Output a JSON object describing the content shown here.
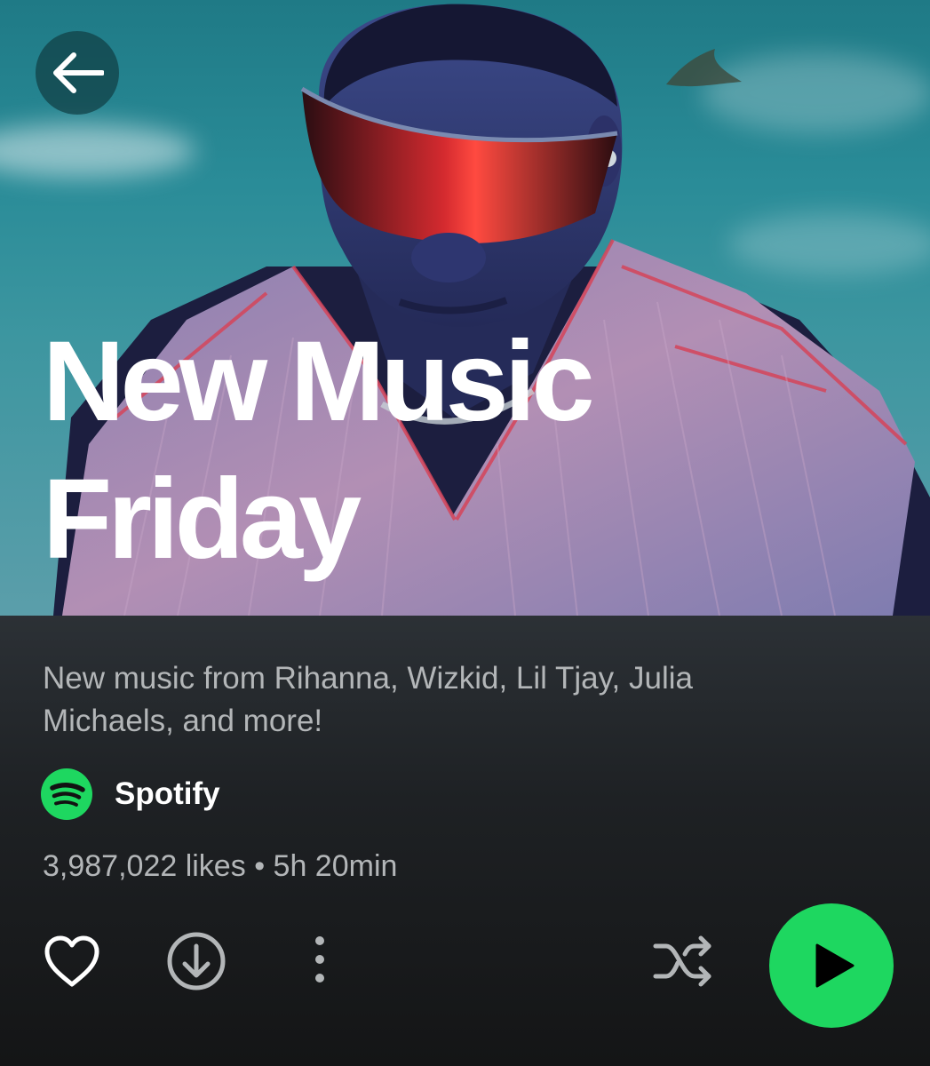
{
  "playlist": {
    "title_line1": "New Music",
    "title_line2": "Friday",
    "description": "New music from Rihanna, Wizkid, Lil Tjay, Julia Michaels, and more!",
    "owner": "Spotify",
    "likes": "3,987,022 likes",
    "separator": "•",
    "duration": "5h 20min"
  },
  "icons": {
    "back": "arrow-left-icon",
    "owner_logo": "spotify-logo-icon",
    "like": "heart-outline-icon",
    "download": "download-circle-icon",
    "more": "more-vertical-icon",
    "shuffle": "shuffle-icon",
    "play": "play-icon"
  },
  "colors": {
    "accent_green": "#1ed760",
    "text_secondary": "#b3b6b8",
    "text_primary": "#ffffff"
  }
}
